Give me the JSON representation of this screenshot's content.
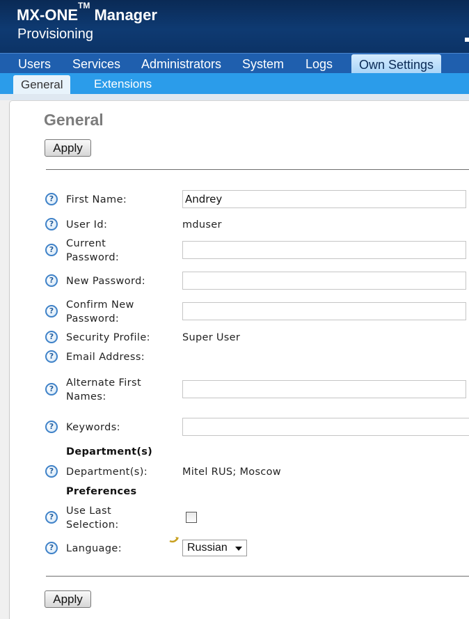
{
  "app": {
    "brand": "MX-ONE",
    "tm": "TM",
    "brand_suffix": " Manager",
    "subtitle": "Provisioning"
  },
  "main_nav": [
    "Users",
    "Services",
    "Administrators",
    "System",
    "Logs",
    "Own Settings"
  ],
  "main_nav_active": "Own Settings",
  "sub_nav": [
    "General",
    "Extensions"
  ],
  "sub_nav_active": "General",
  "page": {
    "title": "General",
    "apply_label": "Apply"
  },
  "help_glyph": "?",
  "fields": {
    "first_name": {
      "label": "First Name:",
      "value": "Andrey"
    },
    "user_id": {
      "label": "User Id:",
      "value": "mduser"
    },
    "current_password": {
      "label_line1": "Current",
      "label_line2": "Password:",
      "value": ""
    },
    "new_password": {
      "label": "New Password:",
      "value": ""
    },
    "confirm_password": {
      "label_line1": "Confirm New",
      "label_line2": "Password:",
      "value": ""
    },
    "security_profile": {
      "label": "Security Profile:",
      "value": "Super User"
    },
    "email": {
      "label": "Email Address:",
      "value": ""
    },
    "alt_first_names": {
      "label_line1": "Alternate First",
      "label_line2": "Names:",
      "value": ""
    },
    "keywords": {
      "label": "Keywords:",
      "value": ""
    },
    "departments": {
      "label": "Department(s):",
      "value": "Mitel RUS; Moscow"
    },
    "use_last_selection": {
      "label_line1": "Use Last",
      "label_line2": "Selection:",
      "checked": false
    },
    "language": {
      "label": "Language:",
      "value": "Russian"
    }
  },
  "sections": {
    "departments": "Department(s)",
    "preferences": "Preferences"
  },
  "colors": {
    "header": "#0e3a72",
    "main_nav": "#1f5fae",
    "sub_nav": "#2b9cea",
    "title_gray": "#7c7c7c"
  },
  "icons": {
    "help": "help-circle-icon",
    "undo": "undo-arrow-icon",
    "dropdown": "chevron-down-icon"
  }
}
